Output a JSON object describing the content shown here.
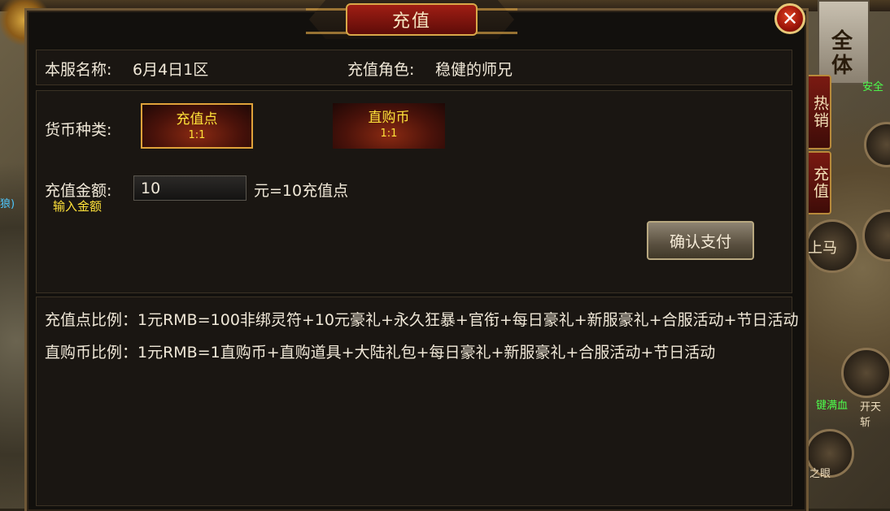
{
  "dialog": {
    "title": "充值",
    "close_symbol": "✕"
  },
  "server": {
    "name_label": "本服名称:",
    "name_value": "6月4日1区",
    "role_label": "充值角色:",
    "role_value": "稳健的师兄"
  },
  "currency": {
    "label": "货币种类:",
    "options": [
      {
        "name": "充值点",
        "rate": "1:1",
        "selected": true
      },
      {
        "name": "直购币",
        "rate": "1:1",
        "selected": false
      }
    ]
  },
  "amount": {
    "label": "充值金额:",
    "hint": "输入金额",
    "value": "10",
    "result": "元=10充值点"
  },
  "pay_button": "确认支付",
  "ratios": [
    "充值点比例：1元RMB=100非绑灵符+10元豪礼+永久狂暴+官衔+每日豪礼+新服豪礼+合服活动+节日活动",
    "直购币比例：1元RMB=1直购币+直购道具+大陆礼包+每日豪礼+新服豪礼+合服活动+节日活动"
  ],
  "side_tabs": [
    "热销",
    "充值"
  ],
  "background_text": {
    "full": "全体",
    "safe": "安全",
    "mount": "上马",
    "heal": "键满血",
    "sword": "开天斩",
    "eye": "之眼",
    "left_label": "狼)"
  },
  "colors": {
    "gold_text": "#ffe23a",
    "panel_bg": "#12100d",
    "accent_red": "#a01e14"
  }
}
